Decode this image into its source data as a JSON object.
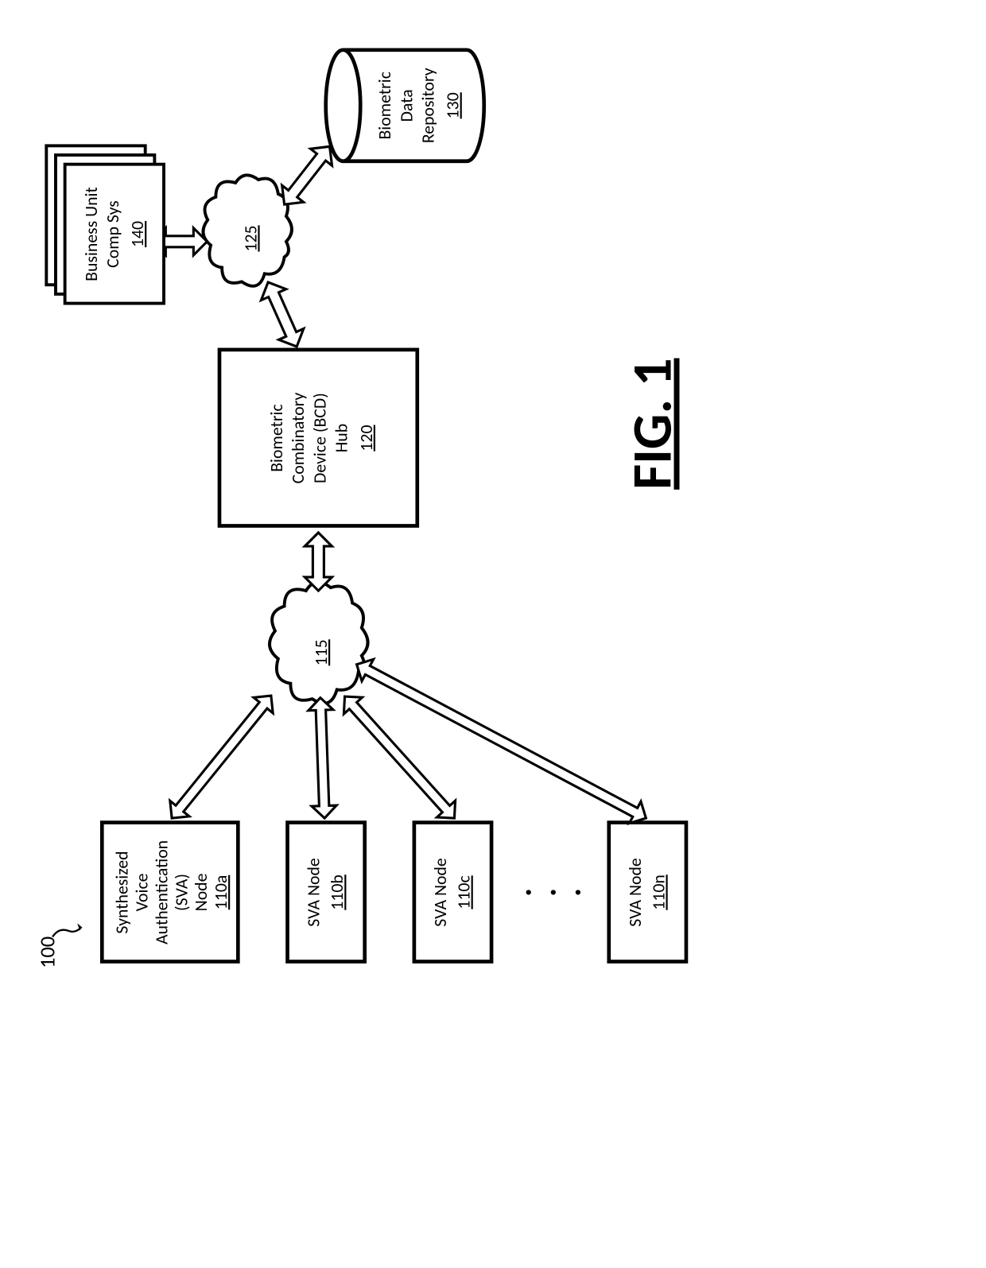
{
  "figure_ref": "100",
  "figure_label": "FIG. 1",
  "nodes": {
    "sva_a": {
      "l1": "Synthesized",
      "l2": "Voice",
      "l3": "Authentication",
      "l4": "(SVA)",
      "l5": "Node",
      "ref": "110a"
    },
    "sva_b": {
      "label": "SVA Node",
      "ref": "110b"
    },
    "sva_c": {
      "label": "SVA Node",
      "ref": "110c"
    },
    "sva_n": {
      "label": "SVA Node",
      "ref": "110n"
    },
    "cloud115": {
      "ref": "115"
    },
    "bcd": {
      "l1": "Biometric",
      "l2": "Combinatory",
      "l3": "Device (BCD)",
      "l4": "Hub",
      "ref": "120"
    },
    "cloud125": {
      "ref": "125"
    },
    "repo": {
      "l1": "Biometric",
      "l2": "Data",
      "l3": "Repository",
      "ref": "130"
    },
    "bu": {
      "l1": "Business Unit",
      "l2": "Comp Sys",
      "ref": "140"
    }
  }
}
